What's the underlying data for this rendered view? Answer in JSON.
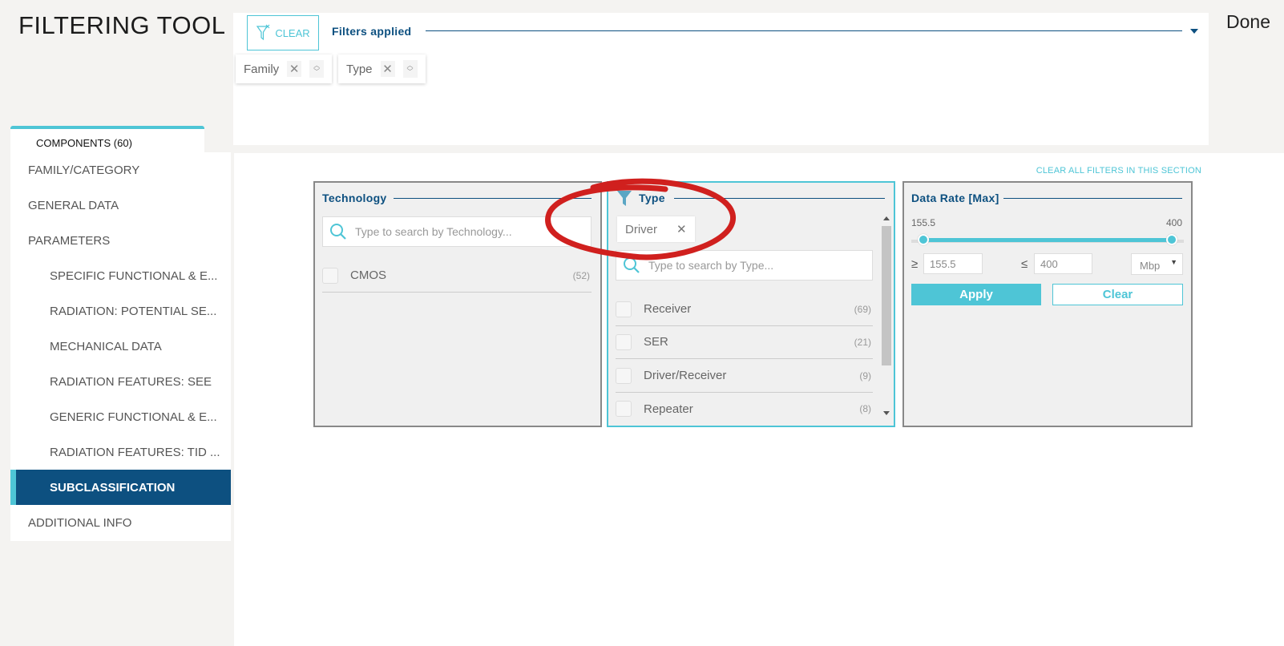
{
  "app": {
    "title": "FILTERING TOOL",
    "done_label": "Done"
  },
  "filters_bar": {
    "clear_label": "CLEAR",
    "label": "Filters applied",
    "chips": [
      {
        "label": "Family"
      },
      {
        "label": "Type"
      }
    ],
    "remove_glyph": "✕",
    "sort_up": "︿",
    "sort_down": "﹀"
  },
  "sidebar": {
    "tab_label": "COMPONENTS (60)",
    "items": [
      {
        "label": "FAMILY/CATEGORY"
      },
      {
        "label": "GENERAL DATA"
      },
      {
        "label": "PARAMETERS"
      },
      {
        "label": "SPECIFIC FUNCTIONAL & E..."
      },
      {
        "label": "RADIATION: POTENTIAL SE..."
      },
      {
        "label": "MECHANICAL DATA"
      },
      {
        "label": "RADIATION FEATURES: SEE"
      },
      {
        "label": "GENERIC FUNCTIONAL & E..."
      },
      {
        "label": "RADIATION FEATURES: TID ..."
      },
      {
        "label": "SUBCLASSIFICATION"
      },
      {
        "label": "ADDITIONAL INFO"
      }
    ],
    "active_item": "SUBCLASSIFICATION"
  },
  "main": {
    "clear_all_label": "CLEAR ALL FILTERS IN THIS SECTION",
    "technology": {
      "title": "Technology",
      "search_placeholder": "Type to search by Technology...",
      "items": [
        {
          "label": "CMOS",
          "count": "(52)"
        }
      ]
    },
    "type": {
      "title": "Type",
      "selected_chip": "Driver",
      "chip_remove": "✕",
      "search_placeholder": "Type to search by Type...",
      "items": [
        {
          "label": "Receiver",
          "count": "(69)"
        },
        {
          "label": "SER",
          "count": "(21)"
        },
        {
          "label": "Driver/Receiver",
          "count": "(9)"
        },
        {
          "label": "Repeater",
          "count": "(8)"
        }
      ]
    },
    "data_rate": {
      "title": "Data Rate [Max]",
      "min_label": "155.5",
      "max_label": "400",
      "min_value": "155.5",
      "max_value": "400",
      "gte_symbol": "≥",
      "lte_symbol": "≤",
      "unit": "Mbp",
      "unit_arrow": "▼",
      "apply_label": "Apply",
      "clear_label": "Clear"
    }
  },
  "colors": {
    "accent": "#4ec5d6",
    "navy": "#0d5080",
    "annotation": "#d0201e"
  }
}
